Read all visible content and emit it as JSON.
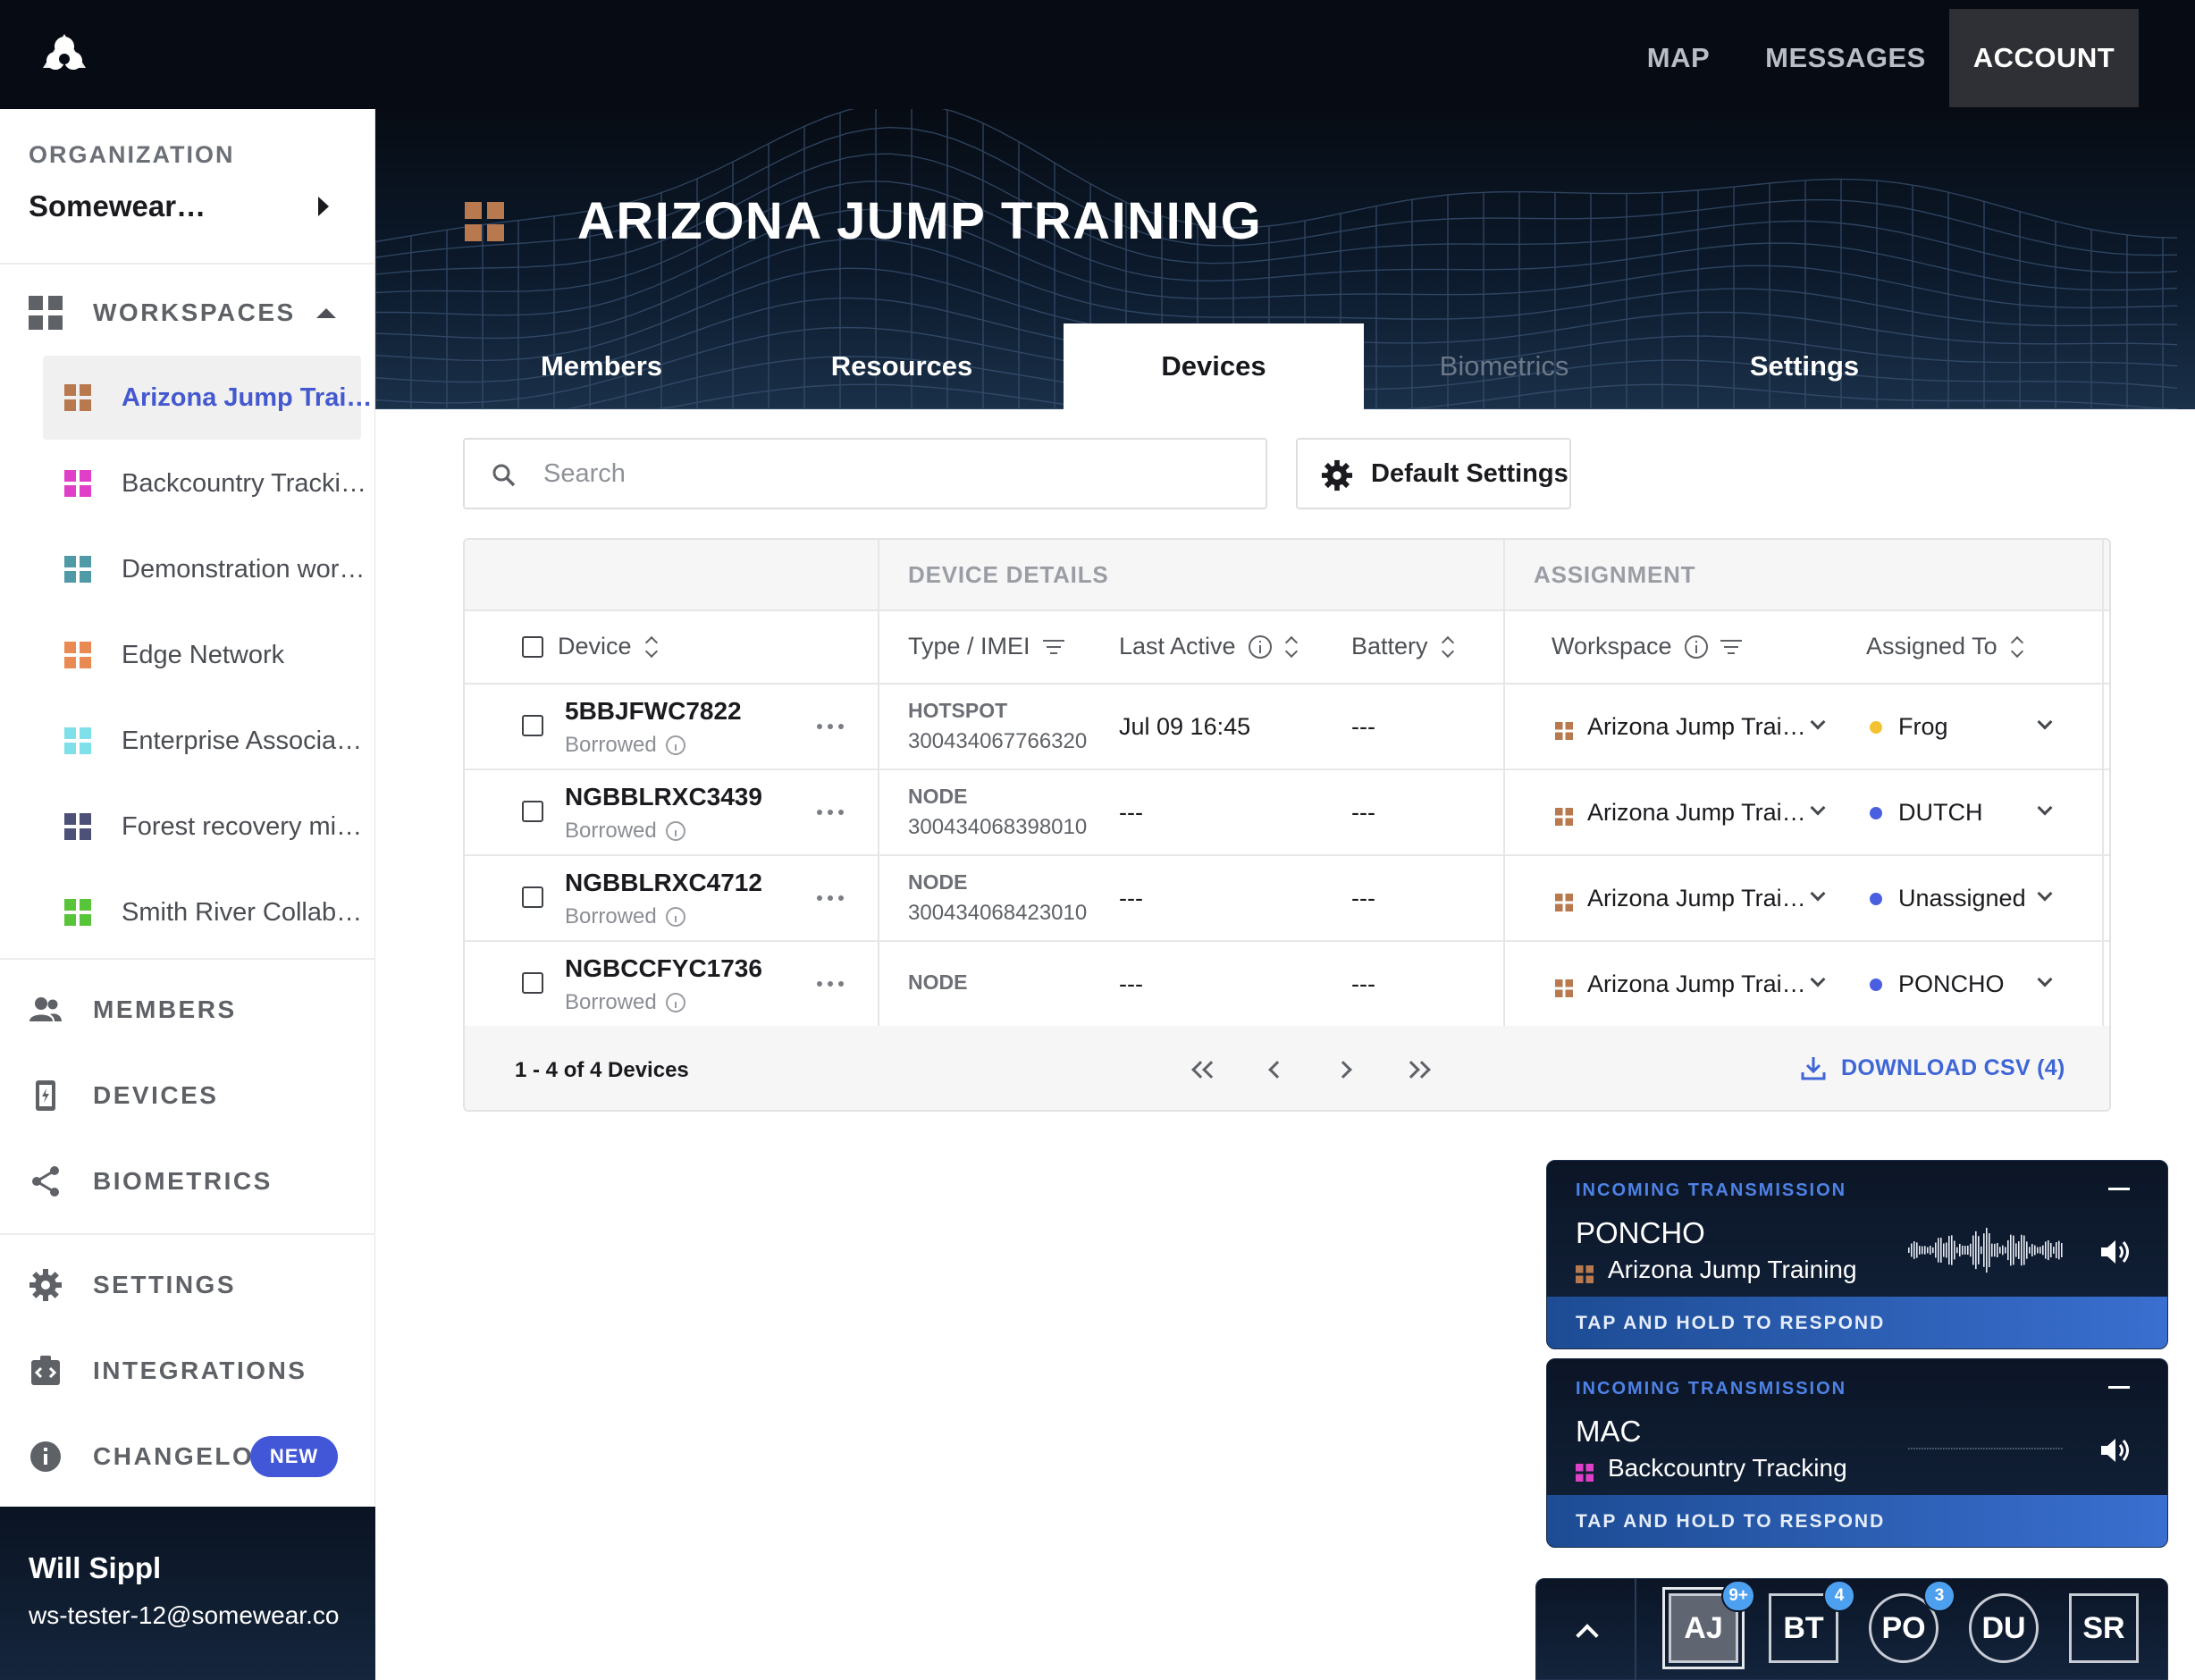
{
  "topnav": {
    "map": "MAP",
    "messages": "MESSAGES",
    "account": "ACCOUNT",
    "active": "ACCOUNT"
  },
  "page": {
    "title": "ARIZONA JUMP TRAINING"
  },
  "tabs": [
    {
      "label": "Members",
      "active": false
    },
    {
      "label": "Resources",
      "active": false
    },
    {
      "label": "Devices",
      "active": true
    },
    {
      "label": "Biometrics",
      "active": false,
      "disabled": true
    },
    {
      "label": "Settings",
      "active": false
    }
  ],
  "sidebar": {
    "org_label": "ORGANIZATION",
    "org_name": "Somewear…",
    "workspaces_label": "WORKSPACES",
    "workspaces": [
      {
        "label": "Arizona Jump Trai…",
        "color": "#b8794e",
        "active": true
      },
      {
        "label": "Backcountry Tracki…",
        "color": "#e040c8",
        "active": false
      },
      {
        "label": "Demonstration wor…",
        "color": "#4f9aa6",
        "active": false
      },
      {
        "label": "Edge Network",
        "color": "#e88a52",
        "active": false
      },
      {
        "label": "Enterprise Associa…",
        "color": "#7fe0ea",
        "active": false
      },
      {
        "label": "Forest recovery mi…",
        "color": "#4d5077",
        "active": false
      },
      {
        "label": "Smith River Collab…",
        "color": "#58c43a",
        "active": false
      }
    ],
    "nav": {
      "members": "MEMBERS",
      "devices": "DEVICES",
      "biometrics": "BIOMETRICS",
      "settings": "SETTINGS",
      "integrations": "INTEGRATIONS",
      "changelog": "CHANGELOG",
      "changelog_badge": "NEW"
    },
    "user": {
      "name": "Will Sippl",
      "email": "ws-tester-12@somewear.co"
    }
  },
  "toolbar": {
    "search_placeholder": "Search",
    "search_value": "",
    "default_settings": "Default Settings"
  },
  "table": {
    "groups": {
      "details": "DEVICE DETAILS",
      "assignment": "ASSIGNMENT"
    },
    "columns": {
      "device": "Device",
      "type": "Type / IMEI",
      "last_active": "Last Active",
      "battery": "Battery",
      "workspace": "Workspace",
      "assigned_to": "Assigned To"
    },
    "rows": [
      {
        "id": "5BBJFWC7822",
        "status": "Borrowed",
        "type": "HOTSPOT",
        "imei": "300434067766320",
        "last_active": "Jul 09 16:45",
        "battery": "---",
        "workspace": "Arizona Jump Trai…",
        "assigned": "Frog",
        "assigned_color": "#f2c230"
      },
      {
        "id": "NGBBLRXC3439",
        "status": "Borrowed",
        "type": "NODE",
        "imei": "300434068398010",
        "last_active": "---",
        "battery": "---",
        "workspace": "Arizona Jump Trai…",
        "assigned": "DUTCH",
        "assigned_color": "#4a5fe0"
      },
      {
        "id": "NGBBLRXC4712",
        "status": "Borrowed",
        "type": "NODE",
        "imei": "300434068423010",
        "last_active": "---",
        "battery": "---",
        "workspace": "Arizona Jump Trai…",
        "assigned": "Unassigned",
        "assigned_color": "#4a5fe0"
      },
      {
        "id": "NGBCCFYC1736",
        "status": "Borrowed",
        "type": "NODE",
        "imei": "",
        "last_active": "---",
        "battery": "---",
        "workspace": "Arizona Jump Trai…",
        "assigned": "PONCHO",
        "assigned_color": "#4a5fe0"
      }
    ],
    "footer": {
      "count": "1 - 4 of 4 Devices",
      "download": "DOWNLOAD CSV (4)"
    }
  },
  "transmissions": [
    {
      "header": "INCOMING TRANSMISSION",
      "name": "PONCHO",
      "workspace": "Arizona Jump Training",
      "ws_color": "#b8794e",
      "action": "TAP AND HOLD TO RESPOND",
      "active_wave": true
    },
    {
      "header": "INCOMING TRANSMISSION",
      "name": "MAC",
      "workspace": "Backcountry Tracking",
      "ws_color": "#e040c8",
      "action": "TAP AND HOLD TO RESPOND",
      "active_wave": false
    }
  ],
  "dock": {
    "avatars": [
      {
        "initials": "AJ",
        "badge": "9+",
        "shape": "square",
        "selected": true
      },
      {
        "initials": "BT",
        "badge": "4",
        "shape": "square",
        "selected": false
      },
      {
        "initials": "PO",
        "badge": "3",
        "shape": "circle",
        "selected": false
      },
      {
        "initials": "DU",
        "badge": "",
        "shape": "circle",
        "selected": false
      },
      {
        "initials": "SR",
        "badge": "",
        "shape": "square",
        "selected": false
      }
    ]
  },
  "colors": {
    "accent": "#4559cf",
    "link": "#3f66d6",
    "nav_bg": "#070c14",
    "tx_bar": "#3a6fd0"
  }
}
